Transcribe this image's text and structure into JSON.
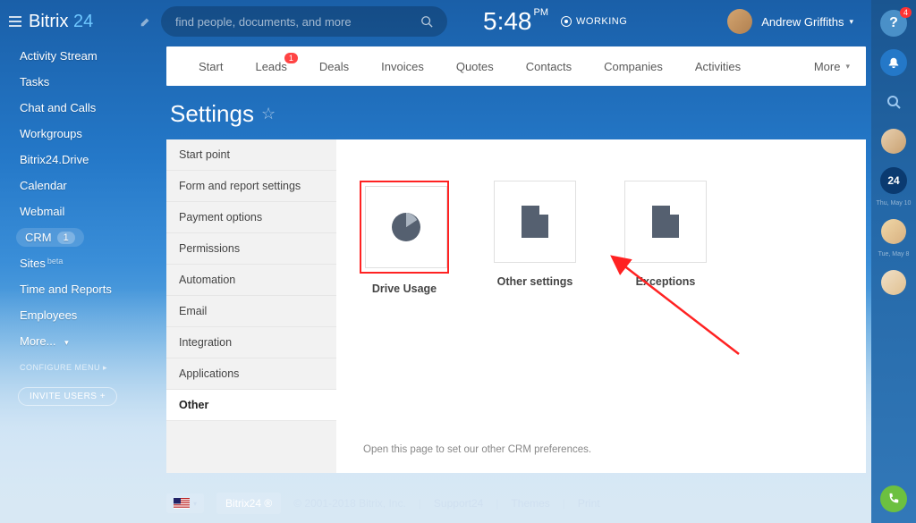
{
  "brand": {
    "name_a": "Bitrix",
    "name_b": " 24"
  },
  "search": {
    "placeholder": "find people, documents, and more"
  },
  "clock": {
    "time": "5:48",
    "ampm": "PM",
    "status": "WORKING"
  },
  "user": {
    "name": "Andrew Griffiths"
  },
  "nav": {
    "activity": "Activity Stream",
    "tasks": "Tasks",
    "chat": "Chat and Calls",
    "workgroups": "Workgroups",
    "drive": "Bitrix24.Drive",
    "calendar": "Calendar",
    "webmail": "Webmail",
    "crm": "CRM",
    "crm_badge": "1",
    "sites": "Sites",
    "sites_beta": "beta",
    "time": "Time and Reports",
    "employees": "Employees",
    "more": "More...",
    "configure": "CONFIGURE MENU",
    "invite": "INVITE USERS  +"
  },
  "tabs": {
    "start": "Start",
    "leads": "Leads",
    "leads_badge": "1",
    "deals": "Deals",
    "invoices": "Invoices",
    "quotes": "Quotes",
    "contacts": "Contacts",
    "companies": "Companies",
    "activities": "Activities",
    "more": "More"
  },
  "page": {
    "title": "Settings"
  },
  "settings_menu": {
    "start": "Start point",
    "form": "Form and report settings",
    "payment": "Payment options",
    "permissions": "Permissions",
    "automation": "Automation",
    "email": "Email",
    "integration": "Integration",
    "applications": "Applications",
    "other": "Other"
  },
  "cards": {
    "drive": "Drive Usage",
    "other": "Other settings",
    "exceptions": "Exceptions",
    "hint": "Open this page to set our other CRM preferences."
  },
  "footer": {
    "brand": "Bitrix24 ®",
    "copyright": "© 2001-2018 Bitrix, Inc.",
    "support": "Support24",
    "themes": "Themes",
    "print": "Print"
  },
  "rail": {
    "help_badge": "4",
    "b24": "24"
  }
}
